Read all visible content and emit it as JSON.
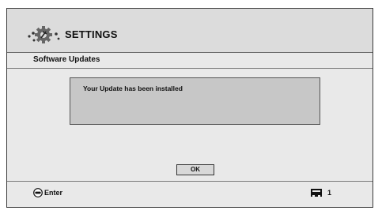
{
  "header": {
    "title": "SETTINGS",
    "logo_icon": "settings-gears-icon"
  },
  "section": {
    "label": "Software Updates"
  },
  "dialog": {
    "message": "Your Update has been installed",
    "ok_label": "OK"
  },
  "footer": {
    "enter_icon": "enter-button-icon",
    "enter_label": "Enter",
    "page_icon": "page-indicator-icon",
    "page_number": "1"
  },
  "colors": {
    "screen_bg": "#e9e9e9",
    "header_bg": "#dcdcdc",
    "dialog_bg": "#c7c7c7",
    "text": "#111111"
  }
}
